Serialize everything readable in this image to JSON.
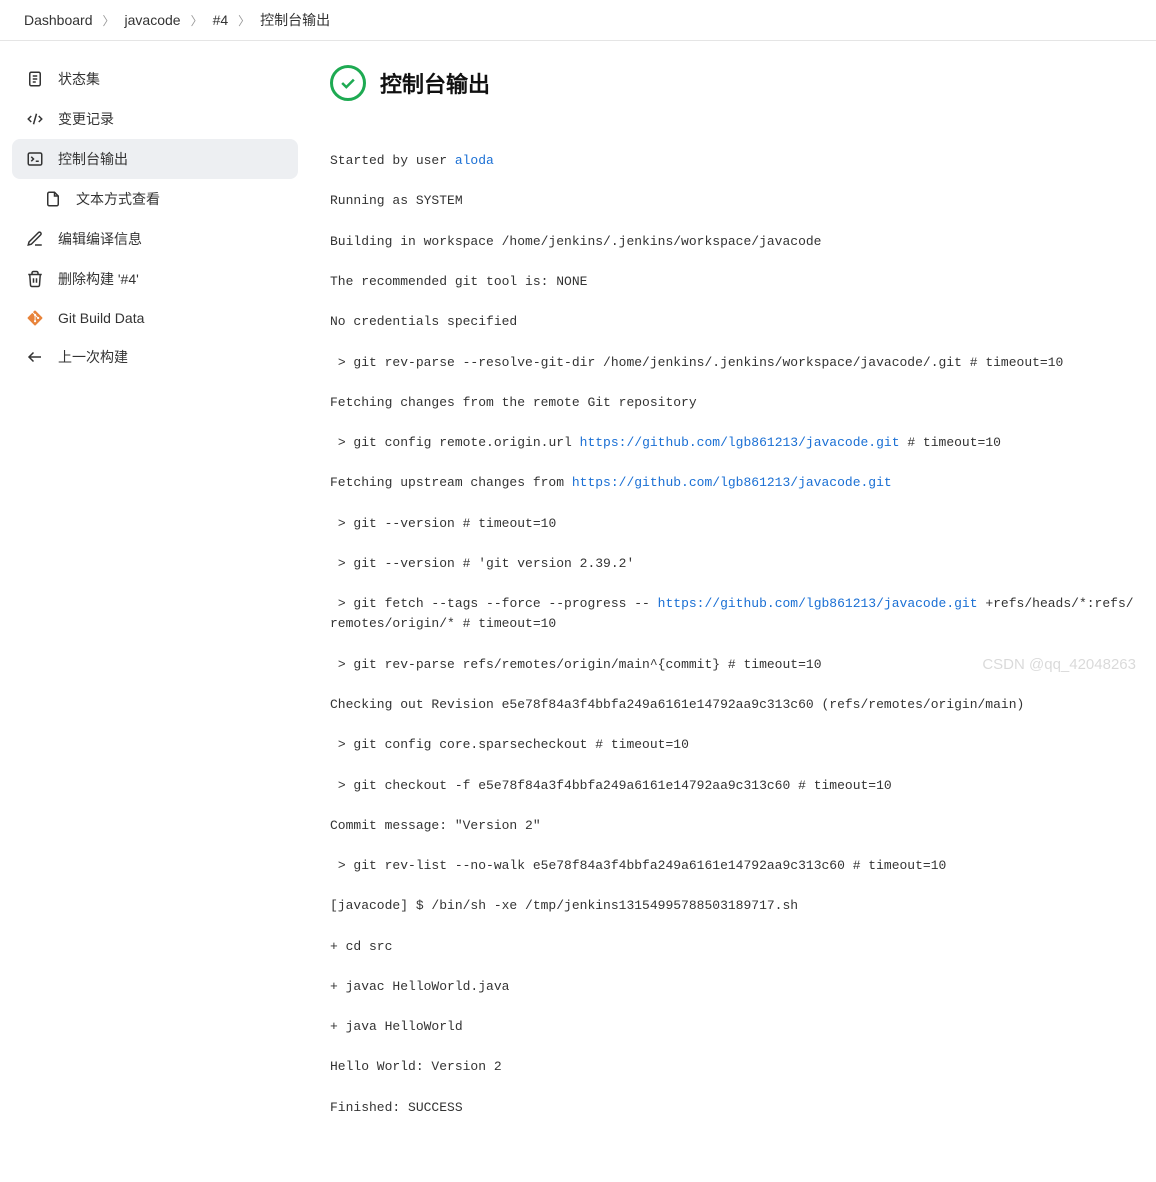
{
  "breadcrumb": {
    "items": [
      "Dashboard",
      "javacode",
      "#4",
      "控制台输出"
    ]
  },
  "sidebar": {
    "items": [
      {
        "label": "状态集"
      },
      {
        "label": "变更记录"
      },
      {
        "label": "控制台输出"
      },
      {
        "label": "文本方式查看"
      },
      {
        "label": "编辑编译信息"
      },
      {
        "label": "删除构建 '#4'"
      },
      {
        "label": "Git Build Data"
      },
      {
        "label": "上一次构建"
      }
    ]
  },
  "header": {
    "title": "控制台输出"
  },
  "console": {
    "l0a": "Started by user ",
    "l0_link": "aloda",
    "l1": "Running as SYSTEM",
    "l2": "Building in workspace /home/jenkins/.jenkins/workspace/javacode",
    "l3": "The recommended git tool is: NONE",
    "l4": "No credentials specified",
    "l5": " > git rev-parse --resolve-git-dir /home/jenkins/.jenkins/workspace/javacode/.git # timeout=10",
    "l6": "Fetching changes from the remote Git repository",
    "l7a": " > git config remote.origin.url ",
    "l7_link": "https://github.com/lgb861213/javacode.git",
    "l7b": " # timeout=10",
    "l8a": "Fetching upstream changes from ",
    "l8_link": "https://github.com/lgb861213/javacode.git",
    "l9": " > git --version # timeout=10",
    "l10": " > git --version # 'git version 2.39.2'",
    "l11a": " > git fetch --tags --force --progress -- ",
    "l11_link": "https://github.com/lgb861213/javacode.git",
    "l11b": " +refs/heads/*:refs/remotes/origin/* # timeout=10",
    "l12": " > git rev-parse refs/remotes/origin/main^{commit} # timeout=10",
    "l13": "Checking out Revision e5e78f84a3f4bbfa249a6161e14792aa9c313c60 (refs/remotes/origin/main)",
    "l14": " > git config core.sparsecheckout # timeout=10",
    "l15": " > git checkout -f e5e78f84a3f4bbfa249a6161e14792aa9c313c60 # timeout=10",
    "l16": "Commit message: \"Version 2\"",
    "l17": " > git rev-list --no-walk e5e78f84a3f4bbfa249a6161e14792aa9c313c60 # timeout=10",
    "l18": "[javacode] $ /bin/sh -xe /tmp/jenkins13154995788503189717.sh",
    "l19": "+ cd src",
    "l20": "+ javac HelloWorld.java",
    "l21": "+ java HelloWorld",
    "l22": "Hello World: Version 2",
    "l23": "Finished: SUCCESS"
  },
  "watermark": "CSDN @qq_42048263"
}
